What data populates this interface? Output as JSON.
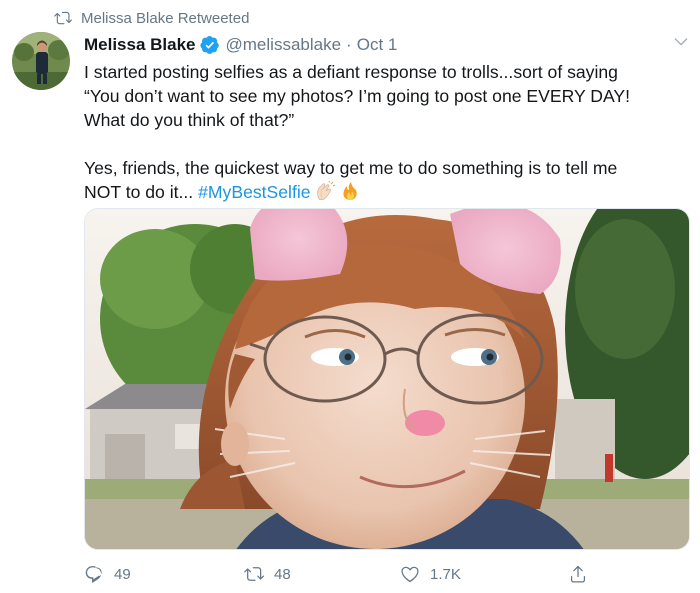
{
  "retweet": {
    "icon": "retweet-icon",
    "label": "Melissa Blake Retweeted"
  },
  "author": {
    "avatar": "avatar",
    "display_name": "Melissa Blake",
    "verified_icon": "verified-badge-icon",
    "handle": "@melissablake",
    "separator": "·",
    "date": "Oct 1"
  },
  "menu_icon": "chevron-down-icon",
  "tweet_text": {
    "line1": "I started posting selfies as a defiant response to trolls...sort of saying",
    "line2": "“You don’t want to see my photos? I’m going to post one EVERY DAY!",
    "line3": "What do you think of that?”",
    "line4": "Yes, friends, the quickest way to get me to do something is to tell me",
    "line5_text": "NOT to do it...",
    "hashtag": "#MyBestSelfie",
    "emojis": [
      "clapping-hands-icon",
      "fire-icon"
    ]
  },
  "media": {
    "type": "photo",
    "icon": "selfie-photo"
  },
  "actions": {
    "reply": {
      "icon": "reply-icon",
      "count": "49"
    },
    "retweet": {
      "icon": "retweet-icon",
      "count": "48"
    },
    "like": {
      "icon": "heart-icon",
      "count": "1.7K"
    },
    "share": {
      "icon": "share-icon"
    }
  },
  "colors": {
    "link": "#1b95e0",
    "secondary_text": "#657786",
    "primary_text": "#14171a",
    "verified": "#1da1f2"
  }
}
